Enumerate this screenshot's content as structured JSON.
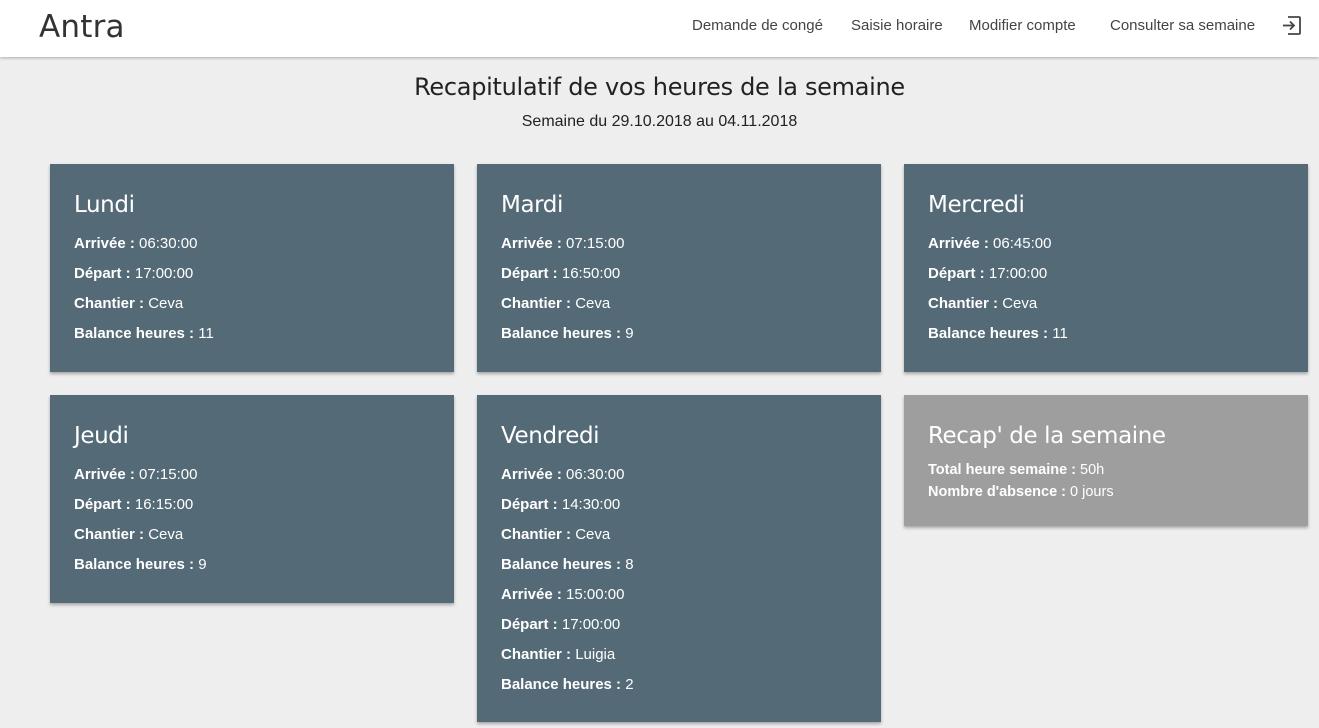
{
  "app": {
    "brand": "Antra"
  },
  "nav": {
    "items": [
      {
        "label": "Demande de congé"
      },
      {
        "label": "Saisie horaire"
      },
      {
        "label": "Modifier compte"
      },
      {
        "label": "Consulter sa semaine"
      }
    ],
    "logout_icon": "logout-icon"
  },
  "header": {
    "title": "Recapitulatif de vos heures de la semaine",
    "subtitle": "Semaine du 29.10.2018 au 04.11.2018"
  },
  "labels": {
    "arrivee": "Arrivée :",
    "depart": "Départ :",
    "chantier": "Chantier :",
    "balance": "Balance heures :"
  },
  "days": [
    {
      "name": "Lundi",
      "entries": [
        {
          "arrivee": "06:30:00",
          "depart": "17:00:00",
          "chantier": "Ceva",
          "balance": "11"
        }
      ]
    },
    {
      "name": "Mardi",
      "entries": [
        {
          "arrivee": "07:15:00",
          "depart": "16:50:00",
          "chantier": "Ceva",
          "balance": "9"
        }
      ]
    },
    {
      "name": "Mercredi",
      "entries": [
        {
          "arrivee": "06:45:00",
          "depart": "17:00:00",
          "chantier": "Ceva",
          "balance": "11"
        }
      ]
    },
    {
      "name": "Jeudi",
      "entries": [
        {
          "arrivee": "07:15:00",
          "depart": "16:15:00",
          "chantier": "Ceva",
          "balance": "9"
        }
      ]
    },
    {
      "name": "Vendredi",
      "entries": [
        {
          "arrivee": "06:30:00",
          "depart": "14:30:00",
          "chantier": "Ceva",
          "balance": "8"
        },
        {
          "arrivee": "15:00:00",
          "depart": "17:00:00",
          "chantier": "Luigia",
          "balance": "2"
        }
      ]
    }
  ],
  "recap": {
    "title": "Recap' de la semaine",
    "total_label": "Total heure semaine :",
    "total_value": "50h",
    "absence_label": "Nombre d'absence :",
    "absence_value": "0 jours"
  },
  "colors": {
    "card": "#546a76",
    "recap_card": "#9e9e9e",
    "background": "#eeeeee",
    "navbar": "#ffffff"
  }
}
